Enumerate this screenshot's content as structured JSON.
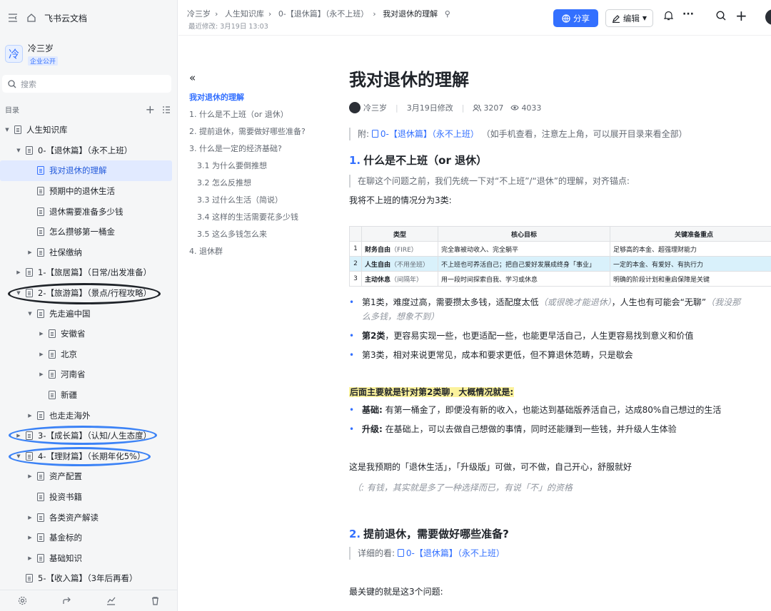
{
  "app": {
    "title": "飞书云文档"
  },
  "space": {
    "name": "冷三岁",
    "badge": "企业公开",
    "logo_char": "冷"
  },
  "search": {
    "placeholder": "搜索"
  },
  "toc_title": "目录",
  "tree": [
    {
      "label": "人生知识库",
      "depth": 0,
      "arrow": "▼"
    },
    {
      "label": "0-【退休篇】（永不上班）",
      "depth": 1,
      "arrow": "▼"
    },
    {
      "label": "我对退休的理解",
      "depth": 2,
      "arrow": "",
      "active": true
    },
    {
      "label": "预期中的退休生活",
      "depth": 2,
      "arrow": ""
    },
    {
      "label": "退休需要准备多少钱",
      "depth": 2,
      "arrow": ""
    },
    {
      "label": "怎么攒够第一桶金",
      "depth": 2,
      "arrow": ""
    },
    {
      "label": "社保缴纳",
      "depth": 2,
      "arrow": "▶"
    },
    {
      "label": "1-【旅居篇】（日常/出发准备）",
      "depth": 1,
      "arrow": "▶"
    },
    {
      "label": "2-【旅游篇】（景点/行程攻略）",
      "depth": 1,
      "arrow": "▼"
    },
    {
      "label": "先走遍中国",
      "depth": 2,
      "arrow": "▼"
    },
    {
      "label": "安徽省",
      "depth": 3,
      "arrow": "▶"
    },
    {
      "label": "北京",
      "depth": 3,
      "arrow": "▶"
    },
    {
      "label": "河南省",
      "depth": 3,
      "arrow": "▶"
    },
    {
      "label": "新疆",
      "depth": 3,
      "arrow": ""
    },
    {
      "label": "也走走海外",
      "depth": 2,
      "arrow": "▶"
    },
    {
      "label": "3-【成长篇】（认知/人生态度）",
      "depth": 1,
      "arrow": "▶"
    },
    {
      "label": "4-【理财篇】（长期年化5%）",
      "depth": 1,
      "arrow": "▼"
    },
    {
      "label": "资产配置",
      "depth": 2,
      "arrow": "▶"
    },
    {
      "label": "投资书籍",
      "depth": 2,
      "arrow": ""
    },
    {
      "label": "各类资产解读",
      "depth": 2,
      "arrow": "▶"
    },
    {
      "label": "基金标的",
      "depth": 2,
      "arrow": "▶"
    },
    {
      "label": "基础知识",
      "depth": 2,
      "arrow": "▶"
    },
    {
      "label": "5-【收入篇】（3年后再看）",
      "depth": 1,
      "arrow": ""
    }
  ],
  "annotation_colors": {
    "dark": "#1f2329",
    "blue": "#3b82f6"
  },
  "breadcrumbs": [
    "冷三岁",
    "人生知识库",
    "0-【退休篇】（永不上班）",
    "我对退休的理解"
  ],
  "modified": "最近修改: 3月19日 13:03",
  "header": {
    "share": "分享",
    "edit": "编辑"
  },
  "outline": [
    {
      "label": "我对退休的理解",
      "level": 0,
      "active": true
    },
    {
      "label": "1. 什么是不上班（or 退休）",
      "level": 0
    },
    {
      "label": "2. 提前退休，需要做好哪些准备?",
      "level": 0
    },
    {
      "label": "3. 什么是一定的经济基础?",
      "level": 0
    },
    {
      "label": "3.1 为什么要倒推想",
      "level": 1
    },
    {
      "label": "3.2 怎么反推想",
      "level": 1
    },
    {
      "label": "3.3 过什么生活（简说）",
      "level": 1
    },
    {
      "label": "3.4 这样的生活需要花多少钱",
      "level": 1
    },
    {
      "label": "3.5 这么多钱怎么来",
      "level": 1
    },
    {
      "label": "4. 退休群",
      "level": 0
    }
  ],
  "doc": {
    "title": "我对退休的理解",
    "author": "冷三岁",
    "date": "3月19日修改",
    "members": "3207",
    "views": "4033",
    "note_prefix": "附:",
    "note_link": "0-【退休篇】（永不上班）",
    "note_suffix": "（如手机查看，注意左上角，可以展开目录来看全部）",
    "h1_num": "1.",
    "h1_text": "什么是不上班（or 退休）",
    "quote1": "在聊这个问题之前，我们先统一下对“不上班”/“退休”的理解，对齐锚点:",
    "p1": "我将不上班的情况分为3类:",
    "table": {
      "headers": [
        "",
        "类型",
        "核心目标",
        "关键准备重点"
      ],
      "rows": [
        {
          "idx": "1",
          "type_b": "财务自由",
          "type_n": "（FIRE）",
          "goal": "完全靠被动收入、完全躺平",
          "key": "足够高的本金、超强理财能力"
        },
        {
          "idx": "2",
          "type_b": "人生自由",
          "type_n": "（不用坐班）",
          "goal": "不上班也可养活自己；把自己爱好发展成终身「事业」",
          "key": "一定的本金、有爱好、有执行力"
        },
        {
          "idx": "3",
          "type_b": "主动休息",
          "type_n": "（间隔年）",
          "goal": "用一段时间探索自我、学习或休息",
          "key": "明确的阶段计划和重启保障是关键"
        }
      ]
    },
    "b1_a": "第1类，难度过高，需要攒太多钱，适配度太低",
    "b1_i": "（或很晚才能退休）",
    "b1_b": "，人生也有可能会“无聊”",
    "b1_i2": "（我没那",
    "b1_i3": "么多钱，想象不到）",
    "b2_bold": "第2类",
    "b2_rest": "，更容易实现一些，也更适配一些，也能更早活自己，人生更容易找到意义和价值",
    "b3": "第3类，相对来说更常见，成本和要求更低，但不算退休范畴，只是歇会",
    "highlight": "后面主要就是针对第2类聊，大概情况就是:",
    "b4_bold": "基础:",
    "b4_rest": "有第一桶金了，即便没有新的收入，也能达到基础版养活自己，达成80%自己想过的生活",
    "b5_bold": "升级:",
    "b5_rest": "在基础上，可以去做自己想做的事情，同时还能赚到一些钱，并升级人生体验",
    "p2": "这是我预期的「退休生活」，「升级版」可做，可不做，自己开心，舒服就好",
    "p3": "（: 有钱，其实就是多了一种选择而已，有说「不」的资格",
    "h2_num": "2.",
    "h2_text": "提前退休，需要做好哪些准备?",
    "quote2_prefix": "详细的看:",
    "quote2_link": "0-【退休篇】（永不上班）",
    "p4": "最关键的就是这3个问题:"
  }
}
